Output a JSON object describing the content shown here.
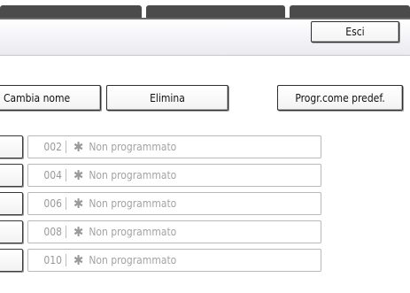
{
  "toolbar": {
    "exit_label": "Esci",
    "rename_label": "Cambia nome",
    "delete_label": "Elimina",
    "set_default_label": "Progr.come predef."
  },
  "list": {
    "items": [
      {
        "number": "002",
        "icon": "asterisk-icon",
        "label": "Non programmato"
      },
      {
        "number": "004",
        "icon": "asterisk-icon",
        "label": "Non programmato"
      },
      {
        "number": "006",
        "icon": "asterisk-icon",
        "label": "Non programmato"
      },
      {
        "number": "008",
        "icon": "asterisk-icon",
        "label": "Non programmato"
      },
      {
        "number": "010",
        "icon": "asterisk-icon",
        "label": "Non programmato"
      }
    ]
  },
  "colors": {
    "tab_fill": "#4b4b4b",
    "disabled_text": "#a0a0a0",
    "button_border": "#2e2e2e"
  }
}
